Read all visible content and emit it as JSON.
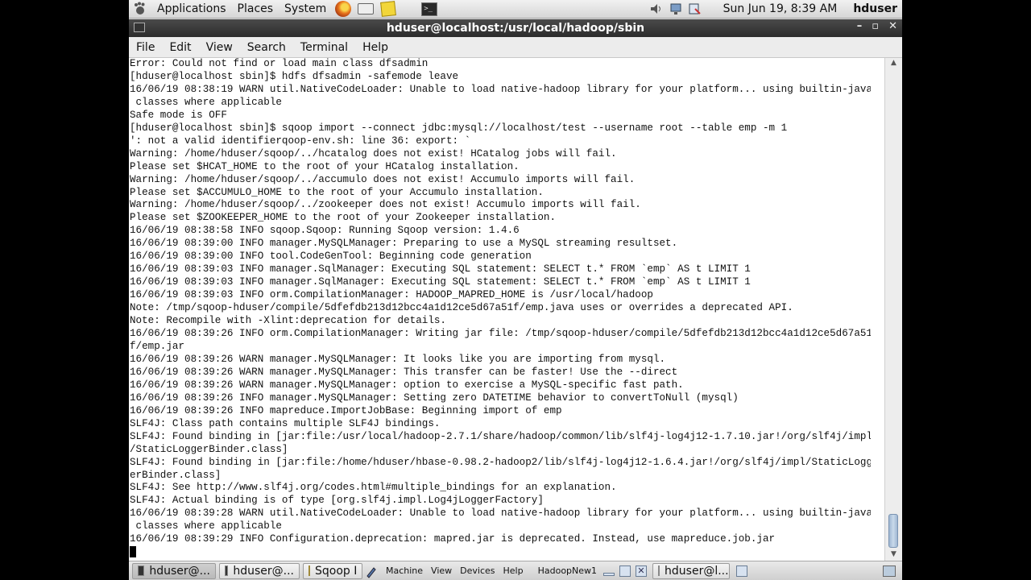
{
  "top_panel": {
    "menus": [
      "Applications",
      "Places",
      "System"
    ],
    "clock": "Sun Jun 19,  8:39 AM",
    "user": "hduser"
  },
  "window": {
    "title": "hduser@localhost:/usr/local/hadoop/sbin",
    "menus": [
      "File",
      "Edit",
      "View",
      "Search",
      "Terminal",
      "Help"
    ]
  },
  "terminal": {
    "lines": [
      "Error: Could not find or load main class dfsadmin",
      "[hduser@localhost sbin]$ hdfs dfsadmin -safemode leave",
      "16/06/19 08:38:19 WARN util.NativeCodeLoader: Unable to load native-hadoop library for your platform... using builtin-java",
      " classes where applicable",
      "Safe mode is OFF",
      "[hduser@localhost sbin]$ sqoop import --connect jdbc:mysql://localhost/test --username root --table emp -m 1",
      "': not a valid identifierqoop-env.sh: line 36: export: `",
      "Warning: /home/hduser/sqoop/../hcatalog does not exist! HCatalog jobs will fail.",
      "Please set $HCAT_HOME to the root of your HCatalog installation.",
      "Warning: /home/hduser/sqoop/../accumulo does not exist! Accumulo imports will fail.",
      "Please set $ACCUMULO_HOME to the root of your Accumulo installation.",
      "Warning: /home/hduser/sqoop/../zookeeper does not exist! Accumulo imports will fail.",
      "Please set $ZOOKEEPER_HOME to the root of your Zookeeper installation.",
      "16/06/19 08:38:58 INFO sqoop.Sqoop: Running Sqoop version: 1.4.6",
      "16/06/19 08:39:00 INFO manager.MySQLManager: Preparing to use a MySQL streaming resultset.",
      "16/06/19 08:39:00 INFO tool.CodeGenTool: Beginning code generation",
      "16/06/19 08:39:03 INFO manager.SqlManager: Executing SQL statement: SELECT t.* FROM `emp` AS t LIMIT 1",
      "16/06/19 08:39:03 INFO manager.SqlManager: Executing SQL statement: SELECT t.* FROM `emp` AS t LIMIT 1",
      "16/06/19 08:39:03 INFO orm.CompilationManager: HADOOP_MAPRED_HOME is /usr/local/hadoop",
      "Note: /tmp/sqoop-hduser/compile/5dfefdb213d12bcc4a1d12ce5d67a51f/emp.java uses or overrides a deprecated API.",
      "Note: Recompile with -Xlint:deprecation for details.",
      "16/06/19 08:39:26 INFO orm.CompilationManager: Writing jar file: /tmp/sqoop-hduser/compile/5dfefdb213d12bcc4a1d12ce5d67a51",
      "f/emp.jar",
      "16/06/19 08:39:26 WARN manager.MySQLManager: It looks like you are importing from mysql.",
      "16/06/19 08:39:26 WARN manager.MySQLManager: This transfer can be faster! Use the --direct",
      "16/06/19 08:39:26 WARN manager.MySQLManager: option to exercise a MySQL-specific fast path.",
      "16/06/19 08:39:26 INFO manager.MySQLManager: Setting zero DATETIME behavior to convertToNull (mysql)",
      "16/06/19 08:39:26 INFO mapreduce.ImportJobBase: Beginning import of emp",
      "SLF4J: Class path contains multiple SLF4J bindings.",
      "SLF4J: Found binding in [jar:file:/usr/local/hadoop-2.7.1/share/hadoop/common/lib/slf4j-log4j12-1.7.10.jar!/org/slf4j/impl",
      "/StaticLoggerBinder.class]",
      "SLF4J: Found binding in [jar:file:/home/hduser/hbase-0.98.2-hadoop2/lib/slf4j-log4j12-1.6.4.jar!/org/slf4j/impl/StaticLogg",
      "erBinder.class]",
      "SLF4J: See http://www.slf4j.org/codes.html#multiple_bindings for an explanation.",
      "SLF4J: Actual binding is of type [org.slf4j.impl.Log4jLoggerFactory]",
      "16/06/19 08:39:28 WARN util.NativeCodeLoader: Unable to load native-hadoop library for your platform... using builtin-java",
      " classes where applicable",
      "16/06/19 08:39:29 INFO Configuration.deprecation: mapred.jar is deprecated. Instead, use mapreduce.job.jar"
    ]
  },
  "taskbar": {
    "task1": "hduser@...",
    "task2": "hduser@...",
    "task3": "Sqoop I",
    "vbox_menus": [
      "Machine",
      "View",
      "Devices",
      "Help"
    ],
    "vbox_title": "HadoopNew1",
    "task4": "hduser@l..."
  }
}
